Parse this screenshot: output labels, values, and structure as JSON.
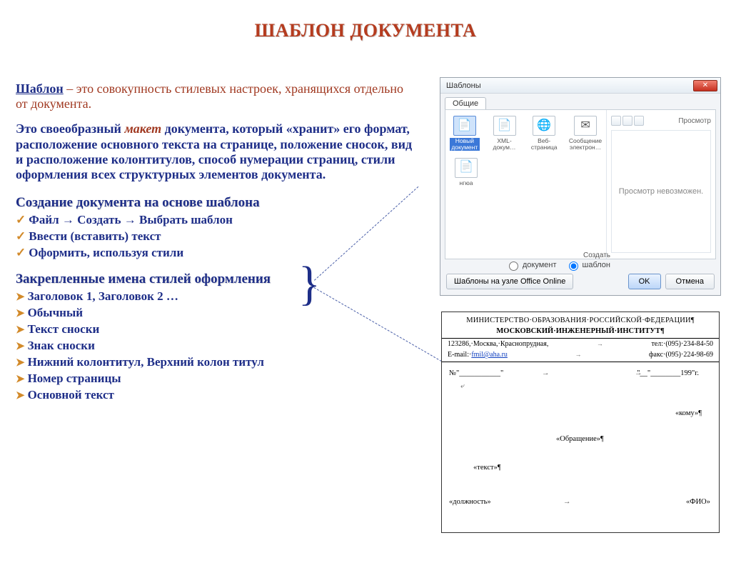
{
  "title": "ШАБЛОН ДОКУМЕНТА",
  "para1_lead": "Шаблон",
  "para1_rest": " – это совокупность стилевых настроек, хранящихся отдельно от документа.",
  "para2_a": "Это своеобразный ",
  "para2_ital": "макет",
  "para2_b": " документа, который  «хранит» его формат, расположение основного текста на странице, положение сносок, вид и расположение колонтитулов, способ нумерации страниц, стили оформления всех структурных элементов документа.",
  "sub1": "Создание документа на основе шаблона",
  "steps": [
    "Файл → Создать → Выбрать шаблон",
    "Ввести (вставить) текст",
    "Оформить, используя стили"
  ],
  "sub2": "Закрепленные имена стилей оформления",
  "styles": [
    "Заголовок 1, Заголовок 2 …",
    "Обычный",
    "Текст сноски",
    "Знак сноски",
    "Нижний колонтитул, Верхний колон титул",
    "Номер страницы",
    "Основной текст"
  ],
  "dialog": {
    "title": "Шаблоны",
    "tab": "Общие",
    "icons": [
      {
        "label": "Новый документ",
        "sel": true
      },
      {
        "label": "XML-докум…"
      },
      {
        "label": "Веб-страница"
      },
      {
        "label": "Сообщение электрон…"
      },
      {
        "label": "нгюа"
      }
    ],
    "preview_label": "Просмотр",
    "preview_text": "Просмотр невозможен.",
    "create_label": "Создать",
    "radio_doc": "документ",
    "radio_tpl": "шаблон",
    "online": "Шаблоны на узле Office Online",
    "ok": "OK",
    "cancel": "Отмена"
  },
  "sample": {
    "hdr1": "МИНИСТЕРСТВО·ОБРАЗОВАНИЯ·РОССИЙСКОЙ·ФЕДЕРАЦИИ¶",
    "hdr2": "МОСКОВСКИЙ·ИНЖЕНЕРНЫЙ·ИНСТИТУТ¶",
    "addr": "123286,·Москва,·Краснопрудная,",
    "email_lbl": "E-mail:·",
    "email": "fmil@aha.ru",
    "tel": "тел:·(095)·234-84-50",
    "fax": "факс·(095)·224-98-69",
    "year": "199",
    "plc_kому": "«кому»¶",
    "plc_obr": "«Обращение»¶",
    "plc_text": "«текст»¶",
    "plc_pos": "«должность»",
    "plc_fio": "«ФИО»"
  }
}
